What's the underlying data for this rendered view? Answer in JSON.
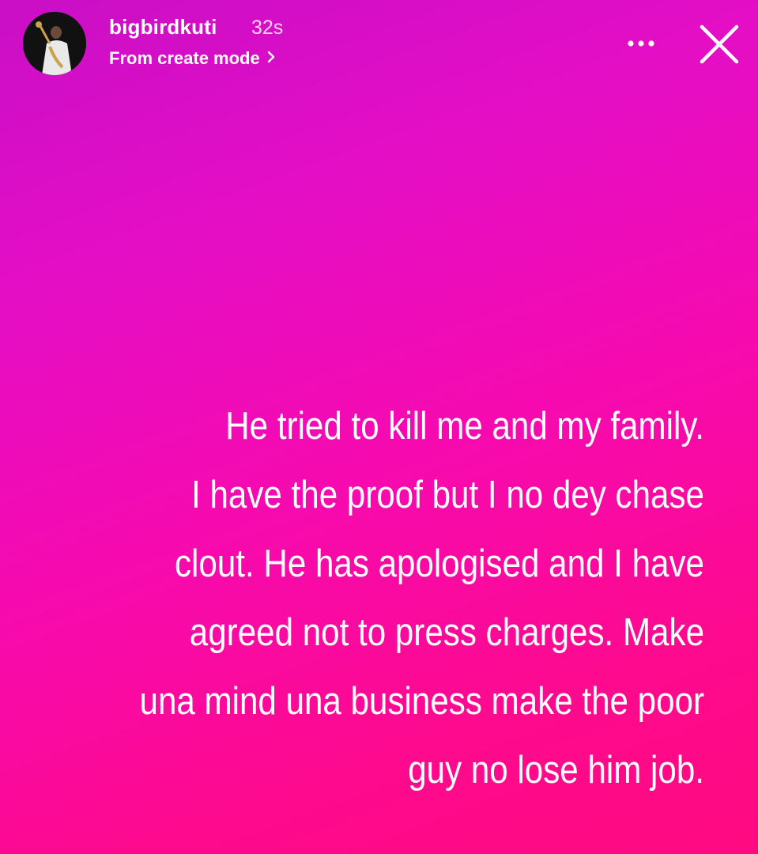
{
  "header": {
    "username": "bigbirdkuti",
    "timestamp": "32s",
    "source_link": "From create mode",
    "avatar_icon": "profile-photo-saxophone",
    "more_icon": "more-horizontal-icon",
    "close_icon": "close-icon"
  },
  "story": {
    "background_gradient": [
      "#c90fc6",
      "#e30ec6",
      "#f70aae",
      "#fd0a8e",
      "#ff0a80"
    ],
    "text_color": "#ffffff",
    "lines": [
      "He tried to kill me and my family.",
      "I have the proof but I no dey chase",
      "clout. He has apologised and I have",
      "agreed not to press charges. Make",
      "una mind una business make the poor",
      "guy no lose him job."
    ]
  }
}
